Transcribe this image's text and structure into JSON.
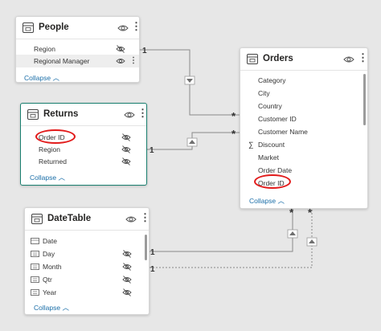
{
  "tables": {
    "people": {
      "title": "People",
      "fields": [
        {
          "name": "Region",
          "hidden": true
        },
        {
          "name": "Regional Manager",
          "hidden": false
        }
      ],
      "collapse": "Collapse"
    },
    "returns": {
      "title": "Returns",
      "fields": [
        {
          "name": "Order ID",
          "hidden": true
        },
        {
          "name": "Region",
          "hidden": true
        },
        {
          "name": "Returned",
          "hidden": true
        }
      ],
      "collapse": "Collapse"
    },
    "datetable": {
      "title": "DateTable",
      "fields": [
        {
          "name": "Date",
          "icon": "calendar-field-icon",
          "hidden": false
        },
        {
          "name": "Day",
          "icon": "hierarchy-field-icon",
          "hidden": true
        },
        {
          "name": "Month",
          "icon": "hierarchy-field-icon",
          "hidden": true
        },
        {
          "name": "Qtr",
          "icon": "hierarchy-field-icon",
          "hidden": true
        },
        {
          "name": "Year",
          "icon": "hierarchy-field-icon",
          "hidden": true
        }
      ],
      "collapse": "Collapse"
    },
    "orders": {
      "title": "Orders",
      "fields": [
        {
          "name": "Category"
        },
        {
          "name": "City"
        },
        {
          "name": "Country"
        },
        {
          "name": "Customer ID"
        },
        {
          "name": "Customer Name"
        },
        {
          "name": "Discount",
          "icon": "sigma-icon"
        },
        {
          "name": "Market"
        },
        {
          "name": "Order Date"
        },
        {
          "name": "Order ID"
        }
      ],
      "collapse": "Collapse"
    }
  },
  "relationships": [
    {
      "from": "People",
      "to": "Orders",
      "from_cardinality": "1",
      "to_cardinality": "*"
    },
    {
      "from": "Returns",
      "to": "Orders",
      "from_cardinality": "1",
      "to_cardinality": "*"
    },
    {
      "from": "DateTable",
      "to": "Orders",
      "from_cardinality": "1",
      "to_cardinality": "*"
    },
    {
      "from": "DateTable",
      "to": "Orders",
      "from_cardinality": "1",
      "to_cardinality": "*",
      "inactive": true
    }
  ],
  "annotations": {
    "highlight_color": "#e21b1b"
  },
  "colors": {
    "selected_border": "#1a7f6f",
    "link": "#1a6ea8",
    "canvas": "#e7e7e7"
  }
}
